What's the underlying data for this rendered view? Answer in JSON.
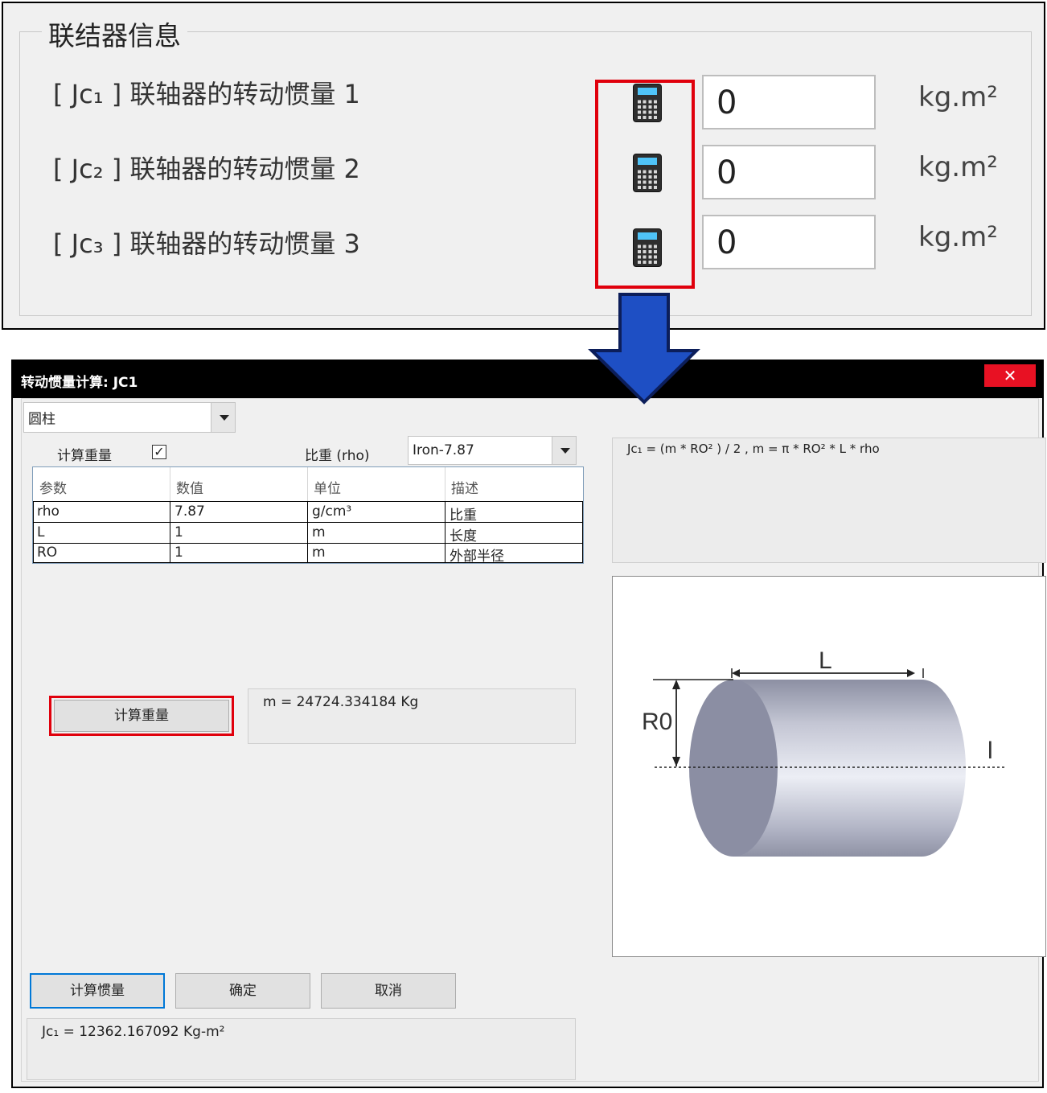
{
  "top_panel": {
    "group_title": "联结器信息",
    "rows": [
      {
        "label": "[ Jc₁ ] 联轴器的转动惯量 1",
        "value": "0",
        "unit": "kg.m²"
      },
      {
        "label": "[ Jc₂ ] 联轴器的转动惯量 2",
        "value": "0",
        "unit": "kg.m²"
      },
      {
        "label": "[ Jc₃ ] 联轴器的转动惯量 3",
        "value": "0",
        "unit": "kg.m²"
      }
    ],
    "calculator_icon": "calculator-icon",
    "highlight_color": "#e0000c"
  },
  "arrow": {
    "color": "#1e4fc4",
    "icon": "arrow-down-icon"
  },
  "dialog": {
    "title": "转动惯量计算: JC1",
    "close_label": "✕",
    "shape_select": "圆柱",
    "calc_weight_label": "计算重量",
    "calc_weight_checked": "✓",
    "density_label": "比重 (rho)",
    "density_select": "Iron-7.87",
    "table": {
      "headers": [
        "参数",
        "数值",
        "单位",
        "描述"
      ],
      "rows": [
        [
          "rho",
          "7.87",
          "g/cm³",
          "比重"
        ],
        [
          "L",
          "1",
          "m",
          "长度"
        ],
        [
          "RO",
          "1",
          "m",
          "外部半径"
        ]
      ]
    },
    "calc_weight_button": "计算重量",
    "weight_result": "m = 24724.334184 Kg",
    "formula": "Jc₁ = (m * RO² ) / 2 ,  m = π * RO² * L * rho",
    "diagram": {
      "label_length": "L",
      "label_radius": "R0",
      "label_axis": "l"
    },
    "buttons": {
      "calc_inertia": "计算惯量",
      "ok": "确定",
      "cancel": "取消"
    },
    "inertia_result": "Jc₁ = 12362.167092 Kg-m²",
    "titlebar_color": "#000000",
    "close_color": "#e81123"
  }
}
